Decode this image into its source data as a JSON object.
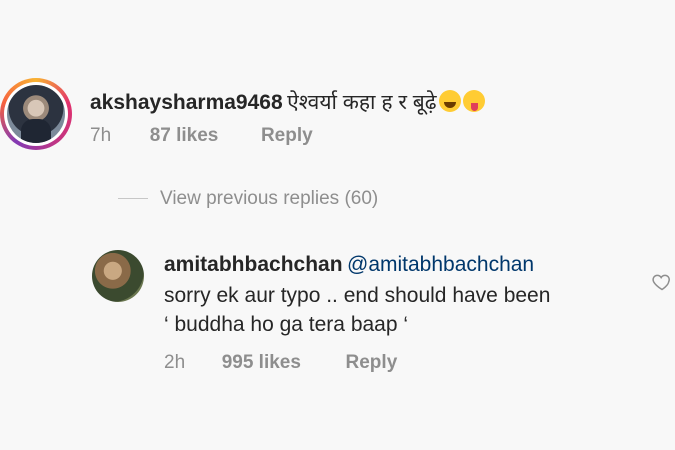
{
  "comment": {
    "username": "akshaysharma9468",
    "text": "ऐश्वर्या कहा ह र बूढ़े",
    "emojis": [
      "face-with-tears-of-joy",
      "face-with-tongue"
    ],
    "time": "7h",
    "likes": "87 likes",
    "reply_label": "Reply"
  },
  "view_previous": {
    "label": "View previous replies (60)"
  },
  "reply": {
    "username": "amitabhbachchan",
    "mention": "@amitabhbachchan",
    "line2": "sorry ek aur typo .. end should have been",
    "line3": "‘ buddha ho ga tera baap ‘",
    "time": "2h",
    "likes": "995 likes",
    "reply_label": "Reply"
  }
}
